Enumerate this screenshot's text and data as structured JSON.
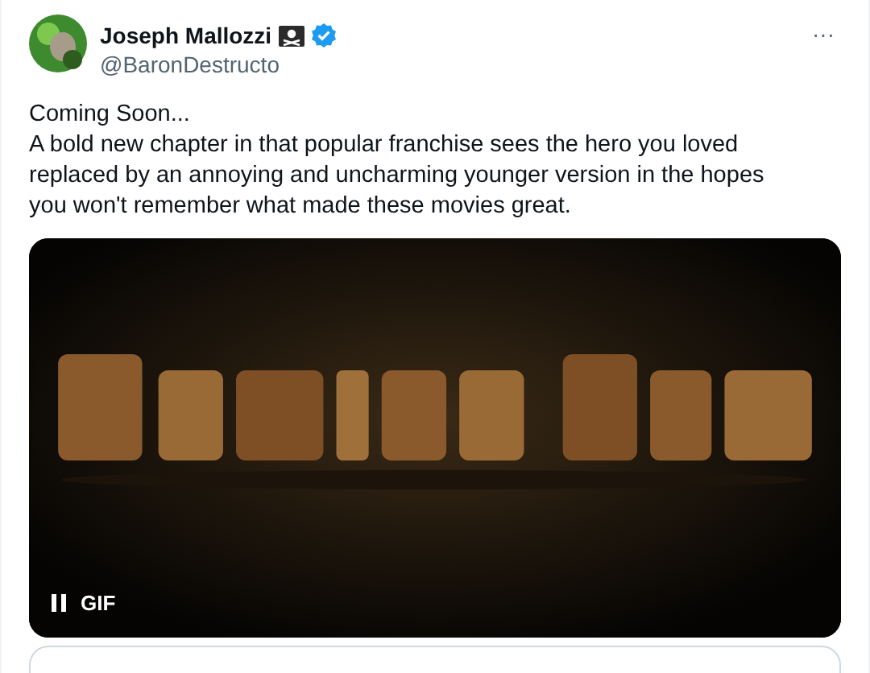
{
  "author": {
    "name": "Joseph Mallozzi",
    "handle": "@BaronDestructo",
    "verified": true
  },
  "more_button": "···",
  "text": [
    "Coming Soon...",
    "A bold new chapter in that popular franchise sees the hero you loved replaced by an annoying and uncharming younger version in the hopes you won't remember what made these movies great."
  ],
  "media": {
    "kind": "picture",
    "badge": "GIF"
  }
}
